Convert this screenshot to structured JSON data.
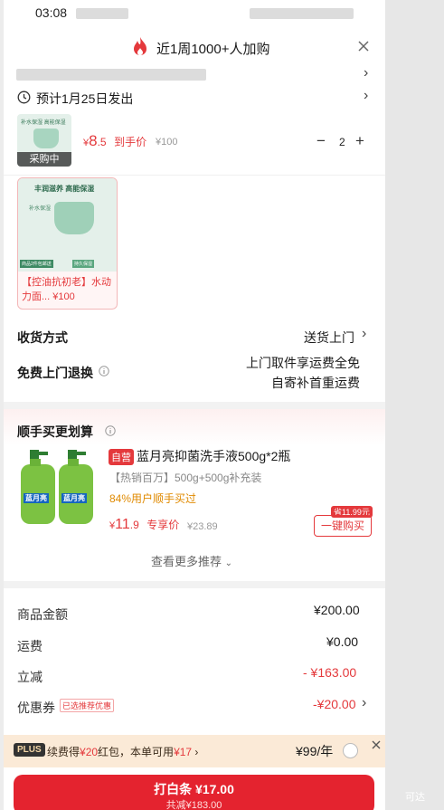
{
  "status": {
    "time": "03:08"
  },
  "header": {
    "title": "近1周1000+人加购"
  },
  "delivery": {
    "estimate": "预计1月25日发出"
  },
  "product": {
    "thumb_badge": "采购中",
    "price_symbol": "¥",
    "price_int": "8",
    "price_dec": ".5",
    "price_tag": "到手价",
    "orig_price": "¥100",
    "qty": "2",
    "minus": "−",
    "plus": "+",
    "img_lines": [
      "补水保湿 高能保湿",
      "丰润滋养 高能保湿",
      "商品2件包邮送",
      "补水保湿",
      "持久保湿"
    ],
    "variant_name": "【控油抗初老】水动力面...",
    "variant_price": "¥100"
  },
  "receive": {
    "label": "收货方式",
    "value": "送货上门"
  },
  "returns": {
    "label": "免费上门退换",
    "line1": "上门取件享运费全免",
    "line2": "自寄补首重运费"
  },
  "recommend": {
    "title": "顺手买更划算",
    "item": {
      "self_tag": "自营",
      "name": "蓝月亮抑菌洗手液500g*2瓶",
      "sub": "【热销百万】500g+500g补充装",
      "stat": "84%用户顺手买过",
      "price_symbol": "¥",
      "price_int": "11",
      "price_dec": ".9",
      "price_tag": "专享价",
      "orig_price": "¥23.89",
      "save_badge": "省11.99元",
      "buy_btn": "一键购买",
      "bottle_label": "蓝月亮"
    },
    "more": "查看更多推荐"
  },
  "summary": {
    "rows": [
      {
        "label": "商品金额",
        "value": "¥200.00"
      },
      {
        "label": "运费",
        "value": "¥0.00"
      },
      {
        "label": "立减",
        "value": "- ¥163.00"
      },
      {
        "label": "优惠券",
        "tag": "已选推荐优惠",
        "value": "-¥20.00"
      }
    ]
  },
  "plus_bar": {
    "badge": "PLUS",
    "text1": "续费得",
    "amount1": "¥20",
    "text2": "红包，本单可用",
    "amount2": "¥17",
    "price": "¥99/年"
  },
  "pay": {
    "main": "打白条 ¥17.00",
    "sub": "共减¥183.00"
  },
  "watermark": "可达"
}
